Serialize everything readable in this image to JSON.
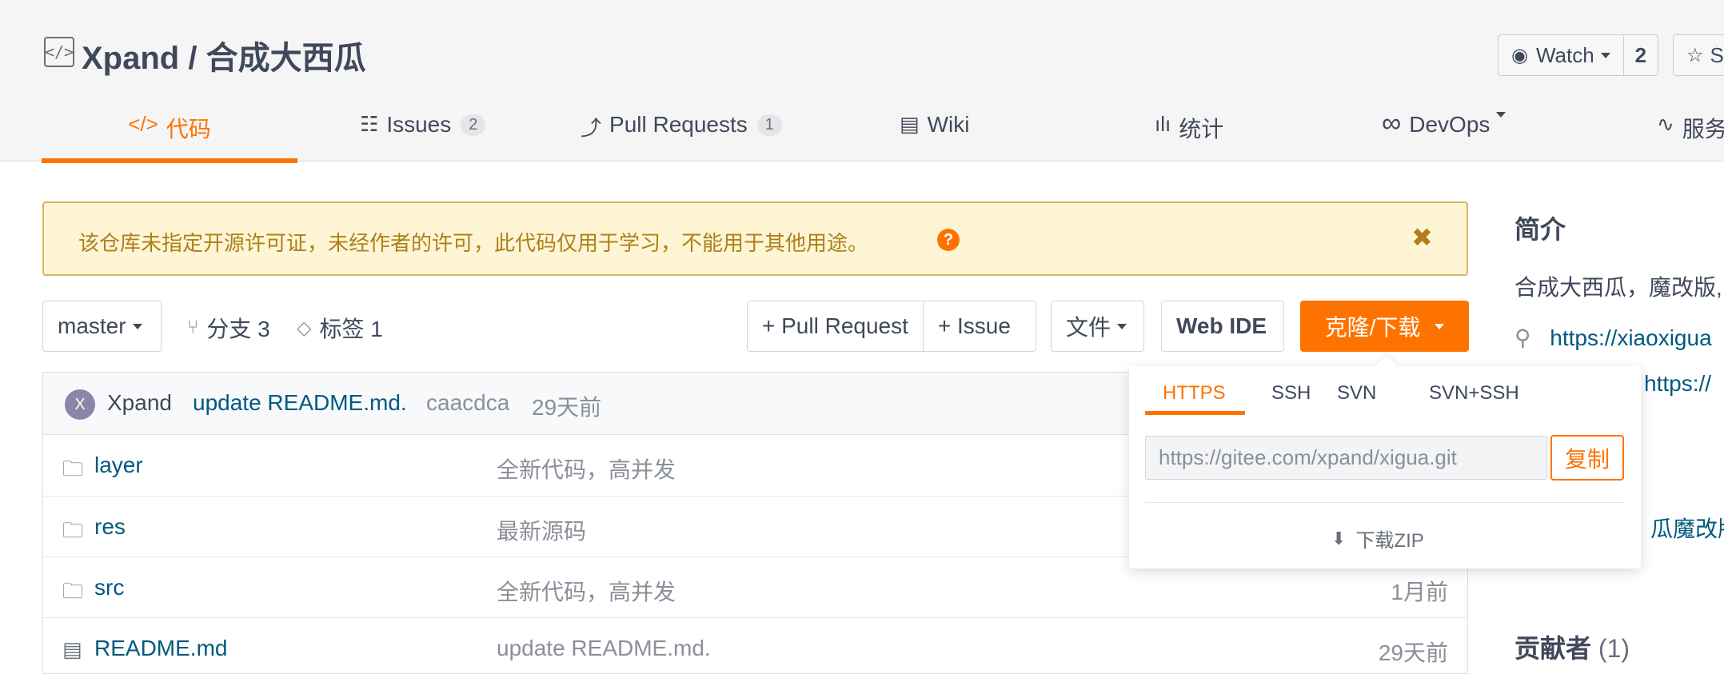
{
  "header": {
    "repo_icon": "code-icon",
    "repo_title": "Xpand / 合成大西瓜",
    "watch_label": "Watch",
    "watch_count": "2",
    "star_label": "S"
  },
  "tabs": [
    {
      "icon": "</>",
      "label": "代码",
      "badge": ""
    },
    {
      "icon": "☷",
      "label": "Issues",
      "badge": "2"
    },
    {
      "icon": "⤴",
      "label": "Pull Requests",
      "badge": "1"
    },
    {
      "icon": "▤",
      "label": "Wiki",
      "badge": ""
    },
    {
      "icon": "ılı",
      "label": "统计",
      "badge": ""
    },
    {
      "icon": "∞",
      "label": "DevOps",
      "badge": ""
    },
    {
      "icon": "∿",
      "label": "服务",
      "badge": ""
    }
  ],
  "notice": {
    "text": "该仓库未指定开源许可证，未经作者的许可，此代码仅用于学习，不能用于其他用途。",
    "help": "?",
    "close": "✖"
  },
  "toolbar": {
    "branch": "master",
    "branches": "分支 3",
    "tags": "标签 1",
    "pull_request": "+ Pull Request",
    "issue": "+ Issue",
    "file": "文件",
    "web_ide": "Web IDE",
    "clone": "克隆/下载"
  },
  "commit": {
    "avatar_letter": "X",
    "author": "Xpand",
    "message": "update README.md.",
    "sha": "caacdca",
    "time": "29天前"
  },
  "files": [
    {
      "icon": "folder-icon",
      "name": "layer",
      "message": "全新代码，高并发",
      "time": ""
    },
    {
      "icon": "folder-icon",
      "name": "res",
      "message": "最新源码",
      "time": ""
    },
    {
      "icon": "folder-icon",
      "name": "src",
      "message": "全新代码，高并发",
      "time": "1月前"
    },
    {
      "icon": "file-icon",
      "name": "README.md",
      "message": "update README.md.",
      "time": "29天前"
    }
  ],
  "sidebar": {
    "title": "简介",
    "description": "合成大西瓜，魔改版,",
    "link1": "https://xiaoxigua",
    "link2": "https://",
    "partial1": "瓜魔改版",
    "contributors_label": "贡献者",
    "contributors_count": "(1)"
  },
  "clone_dropdown": {
    "tabs": [
      "HTTPS",
      "SSH",
      "SVN",
      "SVN+SSH"
    ],
    "url": "https://gitee.com/xpand/xigua.git",
    "copy": "复制",
    "download_zip": "下载ZIP"
  }
}
